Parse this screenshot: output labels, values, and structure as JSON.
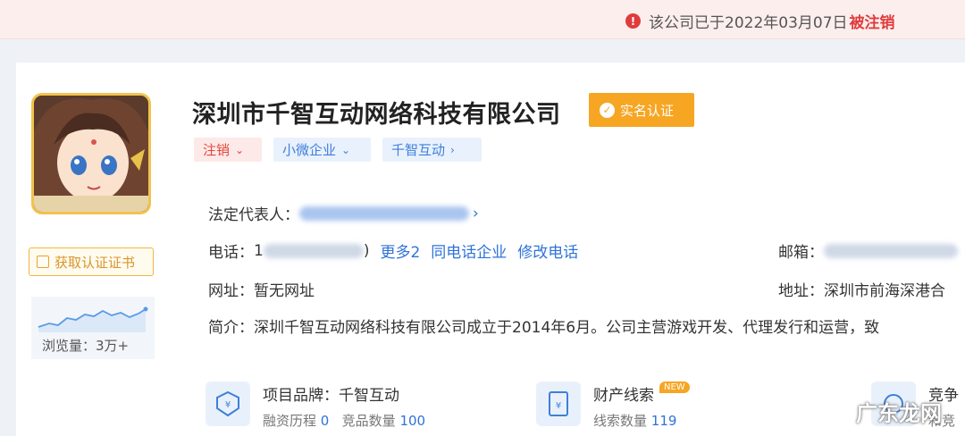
{
  "banner": {
    "message": "该公司已于2022年03月07日",
    "status": "被注销",
    "icon": "alert-circle-icon"
  },
  "company": {
    "name": "深圳市千智互动网络科技有限公司",
    "verified_label": "实名认证",
    "tags": [
      {
        "label": "注销"
      },
      {
        "label": "小微企业"
      },
      {
        "label": "千智互动"
      }
    ]
  },
  "sidebar": {
    "cert_button_label": "获取认证证书",
    "views_label": "浏览量：3万+"
  },
  "details": {
    "legal_rep_label": "法定代表人：",
    "phone_label": "电话：",
    "phone_prefix": "1",
    "phone_more": "更多2",
    "same_phone": "同电话企业",
    "edit_phone": "修改电话",
    "email_label": "邮箱：",
    "website_label": "网址：",
    "website_value": "暂无网址",
    "address_label": "地址：",
    "address_value": "深圳市前海深港合",
    "intro_label": "简介：",
    "intro_value": "深圳千智互动网络科技有限公司成立于2014年6月。公司主营游戏开发、代理发行和运营，致"
  },
  "features": [
    {
      "title": "项目品牌：千智互动",
      "sub1_label": "融资历程",
      "sub1_value": "0",
      "sub2_label": "竞品数量",
      "sub2_value": "100",
      "icon": "project-brand-icon"
    },
    {
      "title": "财产线索",
      "badge": "NEW",
      "sub1_label": "线索数量",
      "sub1_value": "119",
      "icon": "property-clue-icon"
    },
    {
      "title": "竞争",
      "sub1_label": "和竞",
      "icon": "competition-icon"
    }
  ],
  "watermark": "广东龙网"
}
